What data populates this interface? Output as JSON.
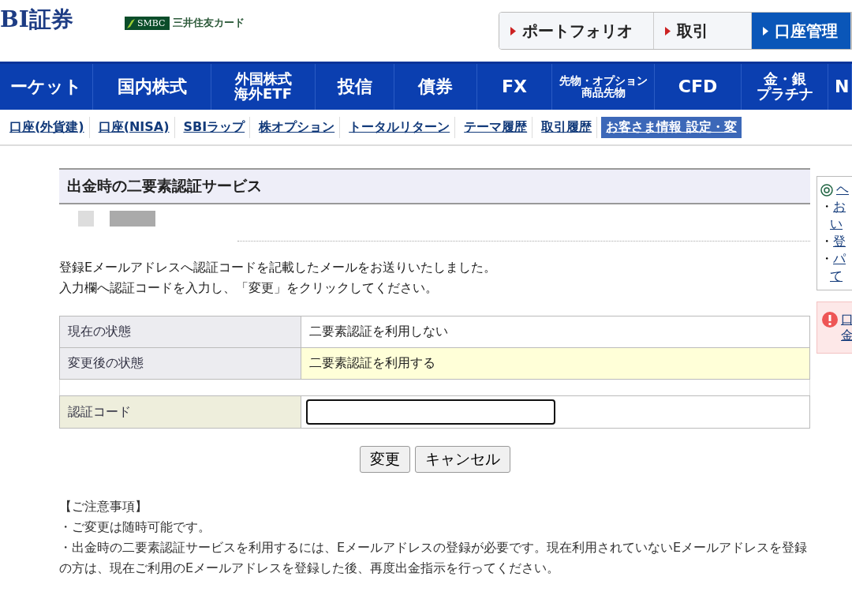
{
  "header": {
    "logo": "BI証券",
    "partner": {
      "badge": "SMBC",
      "name": "三井住友カード"
    }
  },
  "top_tabs": [
    {
      "label": "ポートフォリオ",
      "selected": false
    },
    {
      "label": "取引",
      "selected": false
    },
    {
      "label": "口座管理",
      "selected": true
    }
  ],
  "main_nav": [
    {
      "lines": [
        "ーケット"
      ]
    },
    {
      "lines": [
        "国内株式"
      ]
    },
    {
      "lines": [
        "外国株式",
        "海外ETF"
      ]
    },
    {
      "lines": [
        "投信"
      ]
    },
    {
      "lines": [
        "債券"
      ]
    },
    {
      "lines": [
        "FX"
      ]
    },
    {
      "lines": [
        "先物・オプション",
        "商品先物"
      ]
    },
    {
      "lines": [
        "CFD"
      ]
    },
    {
      "lines": [
        "金・銀",
        "プラチナ"
      ]
    },
    {
      "lines": [
        "N"
      ]
    }
  ],
  "sub_nav": [
    {
      "label": "口座(外貨建)",
      "selected": false
    },
    {
      "label": "口座(NISA)",
      "selected": false
    },
    {
      "label": "SBIラップ",
      "selected": false
    },
    {
      "label": "株オプション",
      "selected": false
    },
    {
      "label": "トータルリターン",
      "selected": false
    },
    {
      "label": "テーマ履歴",
      "selected": false
    },
    {
      "label": "取引履歴",
      "selected": false
    },
    {
      "label": "お客さま情報 設定・変",
      "selected": true
    }
  ],
  "page_title": "出金時の二要素認証サービス",
  "intro": [
    "登録Eメールアドレスへ認証コードを記載したメールをお送りいたしました。",
    "入力欄へ認証コードを入力し、「変更」をクリックしてください。"
  ],
  "status_table": [
    {
      "label": "現在の状態",
      "value": "二要素認証を利用しない",
      "highlighted": false
    },
    {
      "label": "変更後の状態",
      "value": "二要素認証を利用する",
      "highlighted": true
    }
  ],
  "code_field": {
    "label": "認証コード"
  },
  "buttons": [
    "変更",
    "キャンセル"
  ],
  "notes": {
    "title": "【ご注意事項】",
    "items": [
      "・ご変更は随時可能です。",
      "・出金時の二要素認証サービスを利用するには、Eメールアドレスの登録が必要です。現在利用されていないEメールアドレスを登録の方は、現在ご利用のEメールアドレスを登録した後、再度出金指示を行ってください。"
    ]
  },
  "help_panel": {
    "title": "ヘ",
    "links": [
      {
        "bullet": "・",
        "lines": [
          "お",
          "い"
        ]
      },
      {
        "bullet": "・",
        "lines": [
          "登"
        ]
      },
      {
        "bullet": "・",
        "lines": [
          "パ",
          "て"
        ]
      }
    ]
  },
  "alert_panel": {
    "lines": [
      "口",
      "金"
    ]
  }
}
